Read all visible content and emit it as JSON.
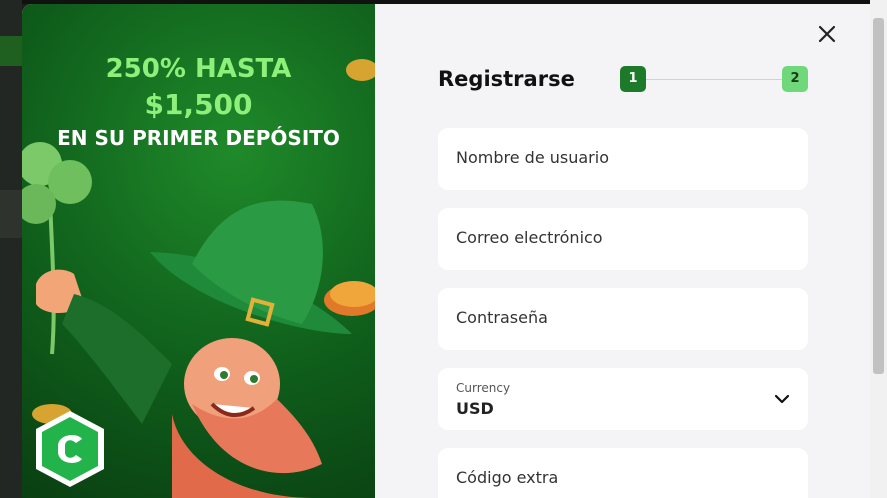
{
  "promo": {
    "line1": "250% HASTA",
    "line2": "$1,500",
    "line3": "EN SU PRIMER DEPÓSITO"
  },
  "form": {
    "title": "Registrarse",
    "steps": [
      "1",
      "2"
    ],
    "fields": {
      "username_placeholder": "Nombre de usuario",
      "email_placeholder": "Correo electrónico",
      "password_placeholder": "Contraseña",
      "currency_label": "Currency",
      "currency_value": "USD",
      "extra_code_placeholder": "Código extra"
    }
  },
  "icons": {
    "close": "close-icon",
    "chevron": "chevron-down-icon"
  },
  "colors": {
    "accent": "#1d7a2a",
    "accent_light": "#6fd87a",
    "promo_text": "#8ef07a"
  }
}
